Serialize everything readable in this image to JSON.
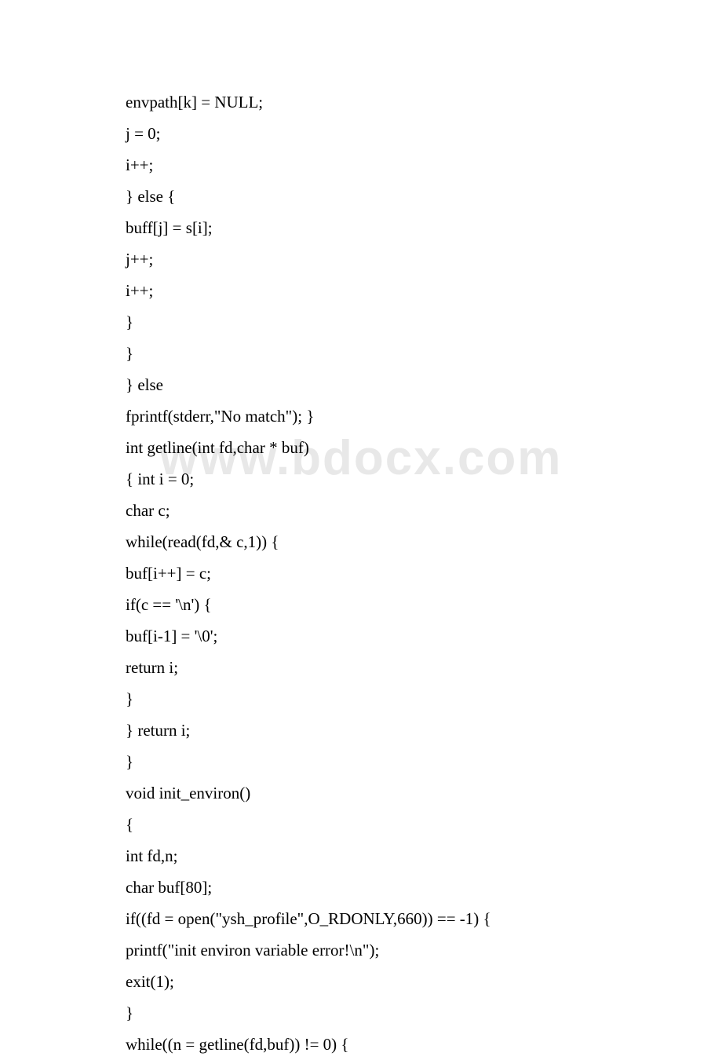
{
  "watermark": "www.bdocx.com",
  "code_lines": [
    "envpath[k] = NULL;",
    "j = 0;",
    "i++;",
    "} else {",
    "buff[j] = s[i];",
    "j++;",
    "i++;",
    "}",
    "}",
    "} else",
    "fprintf(stderr,\"No match\"); }",
    "int getline(int fd,char * buf)",
    "{ int i = 0;",
    "char c;",
    "while(read(fd,& c,1)) {",
    "buf[i++] = c;",
    "if(c == '\\n') {",
    "buf[i-1] = '\\0';",
    "return i;",
    "}",
    "} return i;",
    "}",
    "void init_environ()",
    "{",
    "int fd,n;",
    "char buf[80];",
    "if((fd = open(\"ysh_profile\",O_RDONLY,660)) == -1) {",
    "printf(\"init environ variable error!\\n\");",
    "exit(1);",
    "}",
    "while((n = getline(fd,buf)) != 0) {"
  ]
}
